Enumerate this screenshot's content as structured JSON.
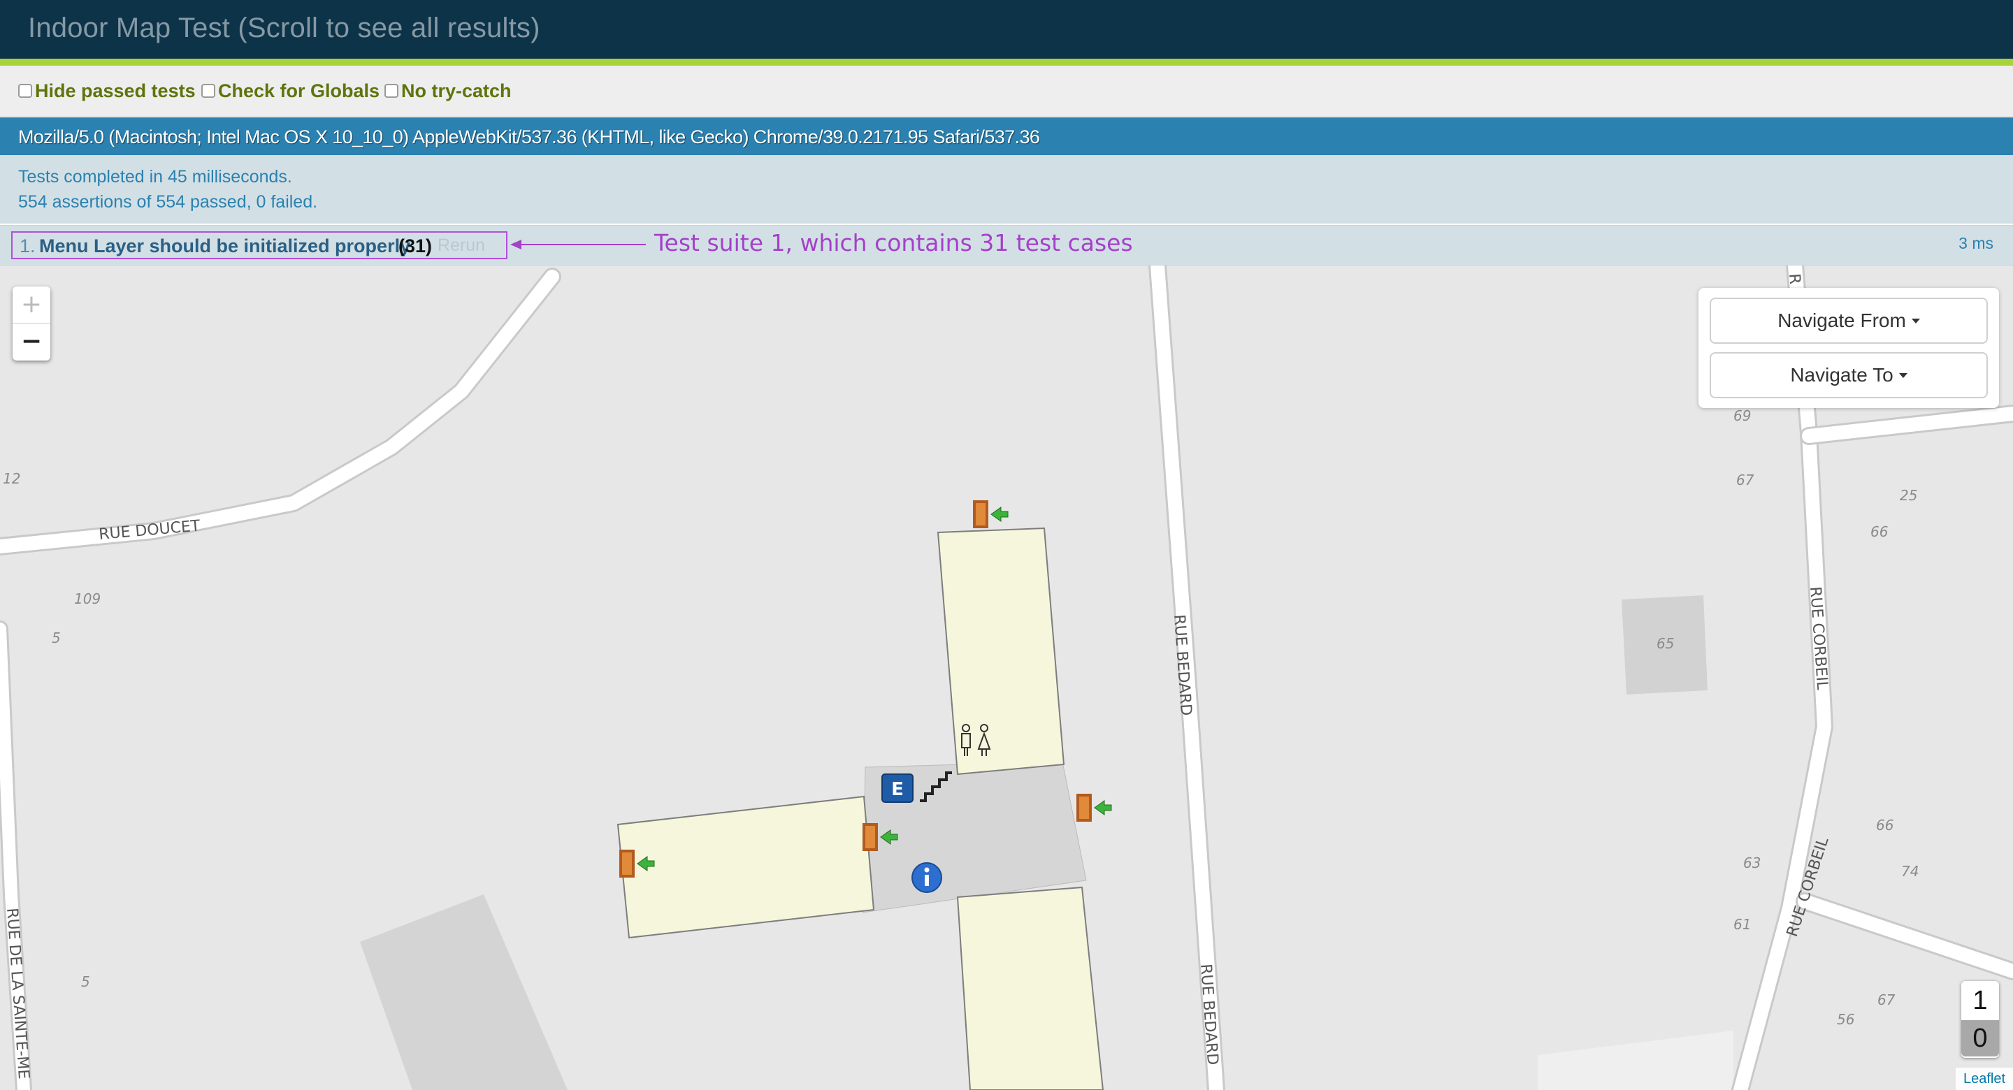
{
  "header": {
    "title": "Indoor Map Test (Scroll to see all results)"
  },
  "toolbar": {
    "hide_passed": "Hide passed tests",
    "check_globals": "Check for Globals",
    "no_try_catch": "No try-catch"
  },
  "user_agent": "Mozilla/5.0 (Macintosh; Intel Mac OS X 10_10_0) AppleWebKit/537.36 (KHTML, like Gecko) Chrome/39.0.2171.95 Safari/537.36",
  "results": {
    "line1": "Tests completed in 45 milliseconds.",
    "line2": "554 assertions of 554 passed, 0 failed."
  },
  "suite": {
    "number": "1.",
    "name": "Menu Layer should be initialized properly",
    "count": "(31)",
    "rerun": "Rerun",
    "time": "3 ms",
    "annotation": "Test suite 1, which contains 31 test cases"
  },
  "map": {
    "zoom_in": "+",
    "zoom_out": "−",
    "navigate_from": "Navigate From",
    "navigate_to": "Navigate To",
    "floors": [
      "1",
      "0"
    ],
    "attribution": "Leaflet",
    "elevator_label": "E",
    "streets": {
      "doucet": "RUE DOUCET",
      "bedard": "RUE BEDARD",
      "corbeil": "RUE CORBEIL",
      "sainte": "RUE DE LA SAINTE-ME",
      "r_top": "R"
    },
    "addresses": [
      "12",
      "109",
      "5",
      "5",
      "69",
      "67",
      "25",
      "66",
      "65",
      "66",
      "63",
      "74",
      "61",
      "67",
      "56"
    ]
  },
  "colors": {
    "header_bg": "#0d3349",
    "header_accent": "#a8d33b",
    "ua_bg": "#2b81af",
    "results_bg": "#d2e0e6",
    "annotation": "#a540c9",
    "room_fill": "#f6f6dc"
  }
}
